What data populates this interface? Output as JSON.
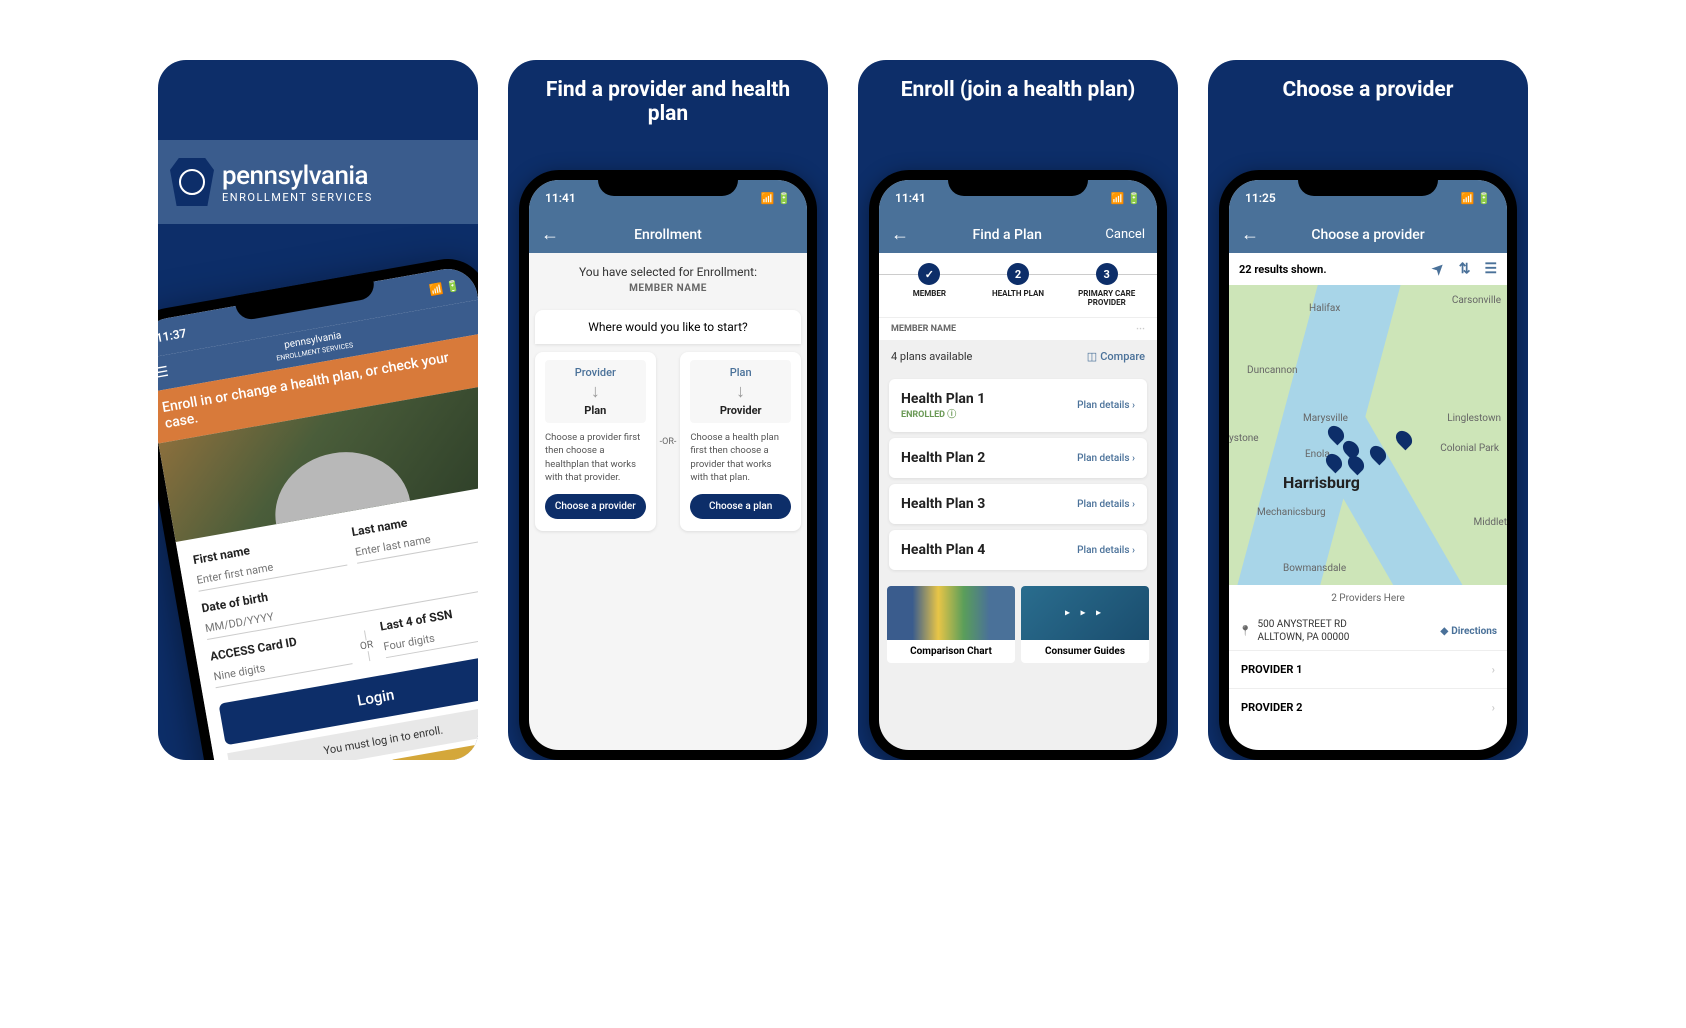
{
  "card1": {
    "logo": {
      "line1": "pennsylvania",
      "line2": "ENROLLMENT SERVICES"
    },
    "statusTime": "11:37",
    "banner": "Enroll in or change a health plan, or check your case.",
    "form": {
      "firstname_label": "First name",
      "firstname_ph": "Enter first name",
      "lastname_label": "Last name",
      "lastname_ph": "Enter last name",
      "dob_label": "Date of birth",
      "dob_ph": "MM/DD/YYYY",
      "access_label": "ACCESS Card ID",
      "access_ph": "Nine digits",
      "or": "OR",
      "ssn_label": "Last 4 of SSN",
      "ssn_ph": "Four digits",
      "login_btn": "Login",
      "note": "You must log in to enroll."
    }
  },
  "card2": {
    "title": "Find a provider and health plan",
    "statusTime": "11:41",
    "header": "Enrollment",
    "selected": "You have selected for Enrollment:",
    "member": "MEMBER NAME",
    "where": "Where would you like to start?",
    "col1": {
      "top": "Provider",
      "bot": "Plan",
      "desc": "Choose a provider first then choose a healthplan that works with that provider.",
      "btn": "Choose a provider"
    },
    "col2": {
      "top": "Plan",
      "bot": "Provider",
      "desc": "Choose a health plan first then choose a provider that works with that plan.",
      "btn": "Choose a plan"
    },
    "or": "-OR-"
  },
  "card3": {
    "title": "Enroll (join a health plan)",
    "statusTime": "11:41",
    "header": "Find a Plan",
    "cancel": "Cancel",
    "steps": [
      "MEMBER",
      "HEALTH PLAN",
      "PRIMARY CARE PROVIDER"
    ],
    "stepnums": [
      "",
      "2",
      "3"
    ],
    "member": "MEMBER NAME",
    "avail": "4 plans available",
    "compare": "Compare",
    "plans": [
      {
        "name": "Health Plan 1",
        "enrolled": "ENROLLED",
        "details": "Plan details"
      },
      {
        "name": "Health Plan 2",
        "enrolled": "",
        "details": "Plan details"
      },
      {
        "name": "Health Plan 3",
        "enrolled": "",
        "details": "Plan details"
      },
      {
        "name": "Health Plan 4",
        "enrolled": "",
        "details": "Plan details"
      }
    ],
    "bc1": "Comparison Chart",
    "bc2": "Consumer Guides"
  },
  "card4": {
    "title": "Choose a provider",
    "statusTime": "11:25",
    "header": "Choose a provider",
    "results": "22 results shown.",
    "cities": {
      "halifax": "Halifax",
      "carsonville": "Carsonville",
      "duncannon": "Duncannon",
      "marysville": "Marysville",
      "linglestown": "Linglestown",
      "enola": "Enola",
      "colonial": "Colonial Park",
      "harrisburg": "Harrisburg",
      "keystone": "ystone",
      "mechanicsburg": "Mechanicsburg",
      "middletown": "Middlet",
      "bowmansdale": "Bowmansdale"
    },
    "provhere": "2 Providers Here",
    "addr1": "500 ANYSTREET RD",
    "addr2": "ALLTOWN, PA 00000",
    "directions": "Directions",
    "prov1": "PROVIDER 1",
    "prov2": "PROVIDER 2"
  }
}
